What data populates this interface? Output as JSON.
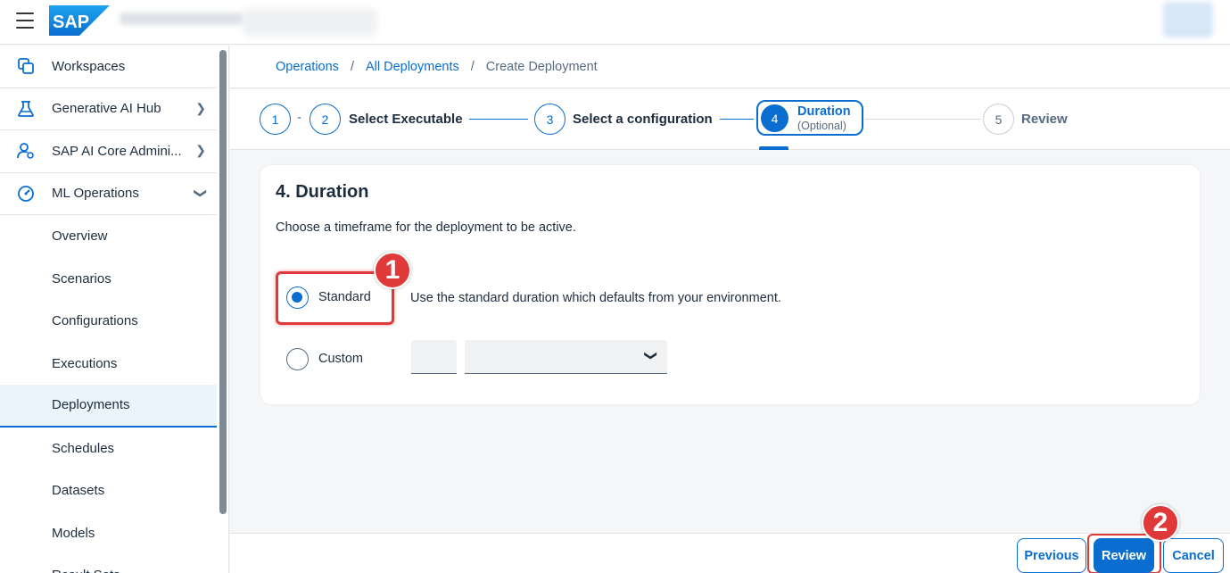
{
  "shell": {
    "logo_text": "SAP",
    "menu_icon": "hamburger-icon"
  },
  "sidebar": {
    "items": [
      {
        "label": "Workspaces",
        "icon": "workspaces-icon"
      },
      {
        "label": "Generative AI Hub",
        "icon": "flask-icon"
      },
      {
        "label": "SAP AI Core Admini...",
        "icon": "user-settings-icon"
      },
      {
        "label": "ML Operations",
        "icon": "gauge-icon"
      }
    ],
    "subitems": [
      {
        "label": "Overview"
      },
      {
        "label": "Scenarios"
      },
      {
        "label": "Configurations"
      },
      {
        "label": "Executions"
      },
      {
        "label": "Deployments",
        "active": true
      },
      {
        "label": "Schedules"
      },
      {
        "label": "Datasets"
      },
      {
        "label": "Models"
      },
      {
        "label": "Result Sets"
      }
    ]
  },
  "breadcrumb": {
    "items": [
      "Operations",
      "All Deployments"
    ],
    "separator": "/",
    "current": "Create Deployment"
  },
  "wizard": {
    "steps": [
      {
        "number": "1",
        "label": ""
      },
      {
        "number": "2",
        "label": "Select Executable"
      },
      {
        "number": "3",
        "label": "Select a configuration"
      },
      {
        "number": "4",
        "label": "Duration",
        "sublabel": "(Optional)",
        "active": true
      },
      {
        "number": "5",
        "label": "Review"
      }
    ],
    "dash": "-"
  },
  "duration": {
    "title": "4. Duration",
    "description": "Choose a timeframe for the deployment to be active.",
    "options": [
      {
        "label": "Standard",
        "checked": true,
        "description": "Use the standard duration which defaults from your environment."
      },
      {
        "label": "Custom",
        "checked": false
      }
    ],
    "custom_value": "",
    "custom_unit": ""
  },
  "annotations": {
    "badge1": "1",
    "badge2": "2",
    "highlight_color": "#e0393a"
  },
  "footer": {
    "previous_label": "Previous",
    "review_label": "Review",
    "cancel_label": "Cancel"
  },
  "colors": {
    "accent": "#0a6ed1",
    "text": "#1d2d3e",
    "annotation_red": "#e0393a"
  }
}
